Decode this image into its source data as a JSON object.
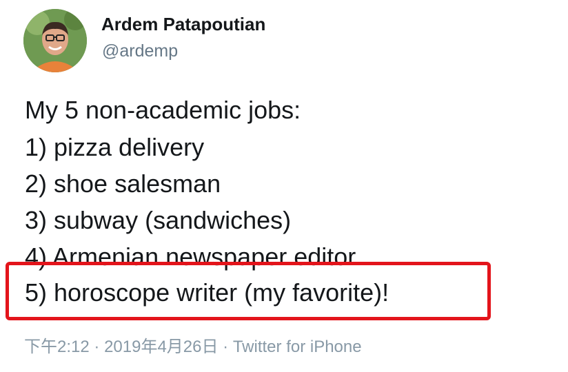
{
  "user": {
    "name": "Ardem Patapoutian",
    "handle": "@ardemp",
    "avatar_icon": "person-photo"
  },
  "tweet": {
    "lines": [
      "My 5 non-academic jobs:",
      "1) pizza delivery",
      "2) shoe salesman",
      "3) subway (sandwiches)",
      "4) Armenian newspaper editor",
      "5) horoscope writer (my favorite)!"
    ],
    "time": "下午2:12",
    "separator": "·",
    "date": "2019年4月26日",
    "source": "Twitter for iPhone"
  },
  "colors": {
    "highlight": "#e3141b",
    "meta": "#8899a6",
    "handle": "#657786",
    "text": "#14171a"
  }
}
